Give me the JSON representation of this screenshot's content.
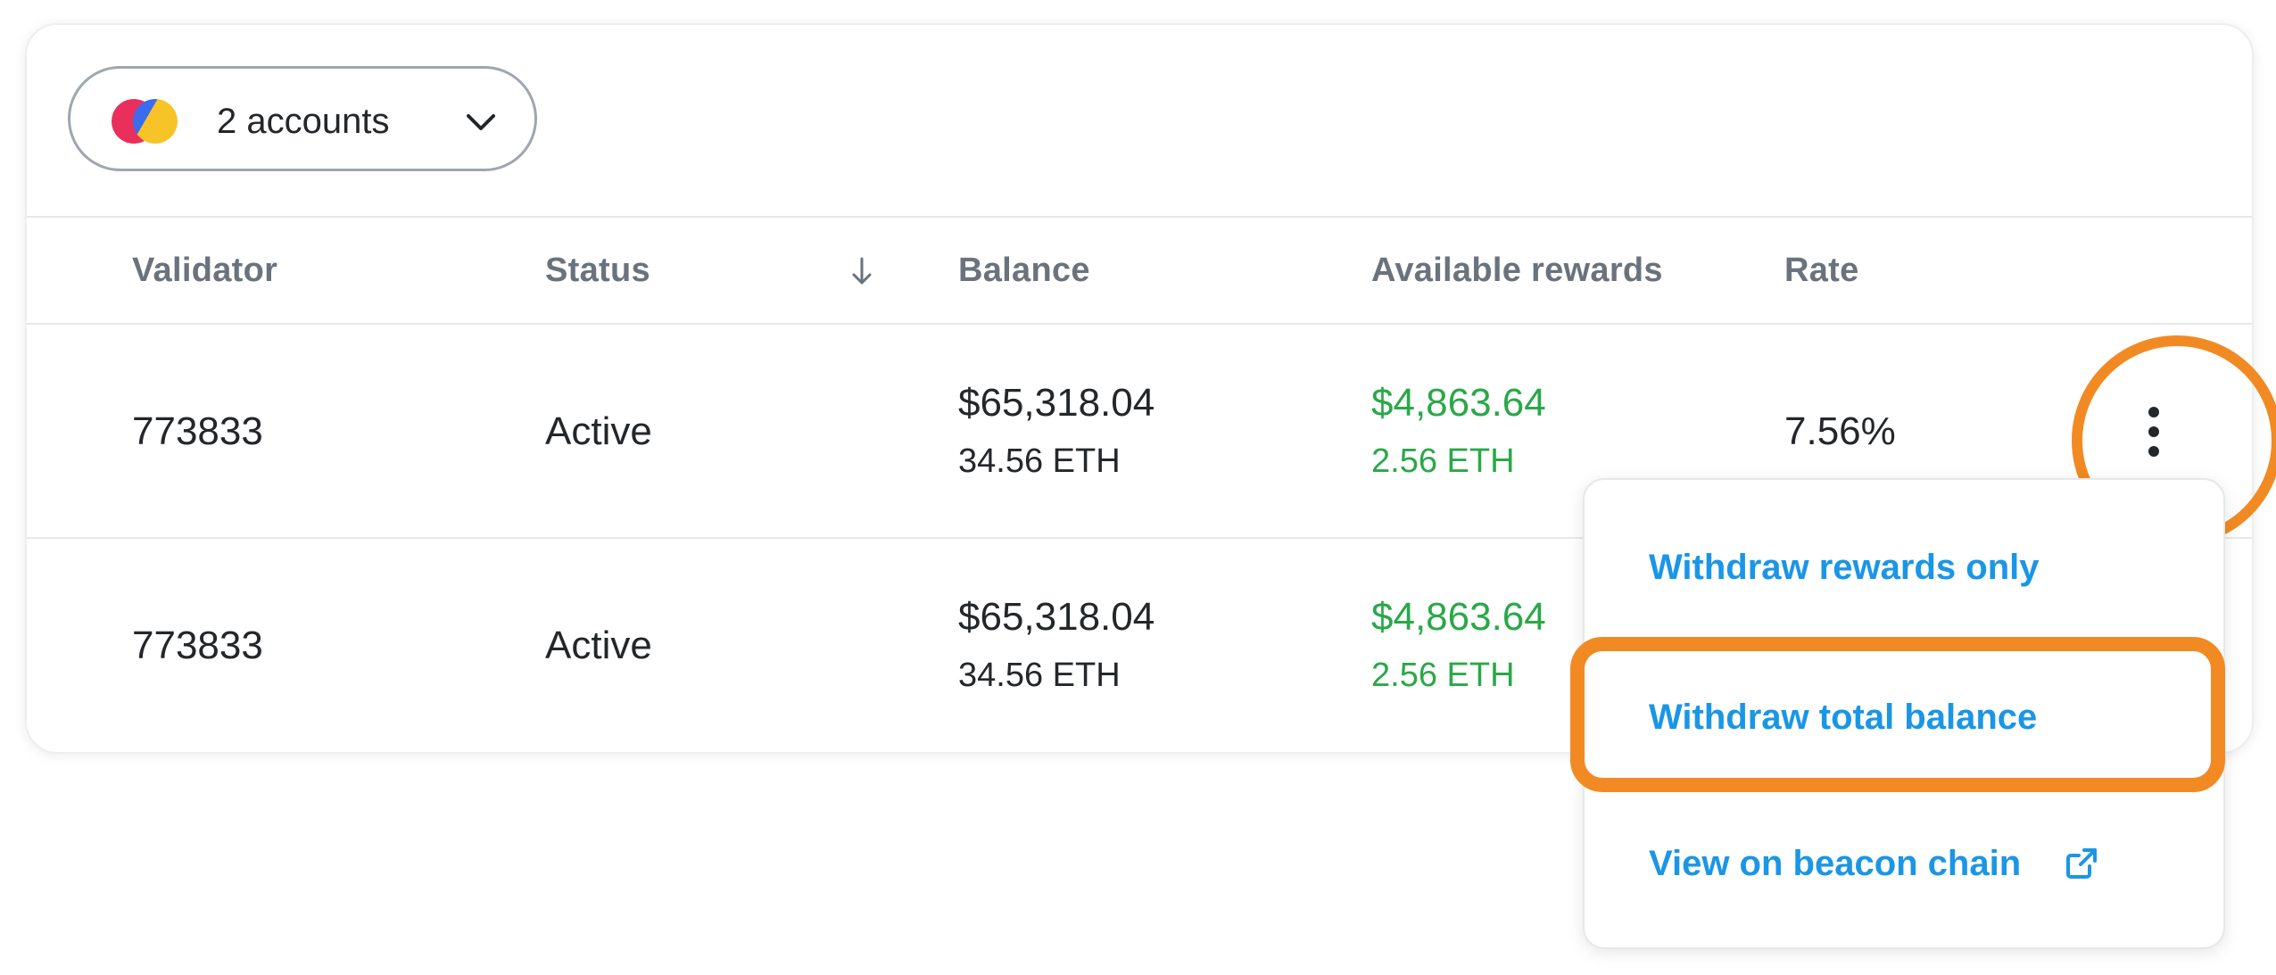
{
  "account_selector": {
    "label": "2 accounts",
    "icon": "chevron-down-icon"
  },
  "table": {
    "columns": [
      "Validator",
      "Status",
      "Balance",
      "Available rewards",
      "Rate"
    ],
    "sort_icon": "arrow-down-icon",
    "rows": [
      {
        "validator": "773833",
        "status": "Active",
        "balance_usd": "$65,318.04",
        "balance_eth": "34.56 ETH",
        "rewards_usd": "$4,863.64",
        "rewards_eth": "2.56 ETH",
        "rate": "7.56%"
      },
      {
        "validator": "773833",
        "status": "Active",
        "balance_usd": "$65,318.04",
        "balance_eth": "34.56 ETH",
        "rewards_usd": "$4,863.64",
        "rewards_eth": "2.56 ETH",
        "rate": ""
      }
    ]
  },
  "menu": {
    "items": [
      "Withdraw rewards only",
      "Withdraw total balance",
      "View on beacon chain"
    ],
    "external_icon": "external-link-icon"
  },
  "colors": {
    "accent_blue": "#1a96e6",
    "reward_green": "#2aa848",
    "highlight_orange": "#f28a23",
    "header_gray": "#6a737d"
  }
}
